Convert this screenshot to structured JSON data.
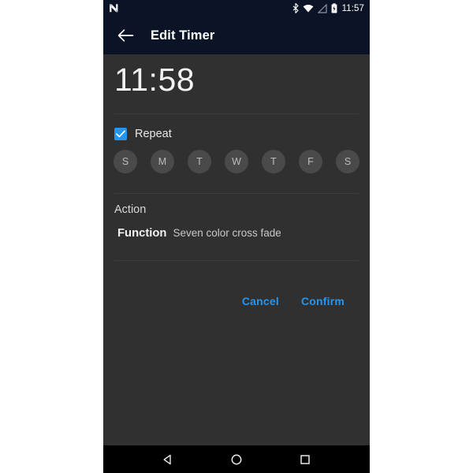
{
  "status_bar": {
    "logo_icon": "android-n-logo-icon",
    "icons": [
      {
        "name": "bluetooth-icon"
      },
      {
        "name": "wifi-off-icon"
      },
      {
        "name": "cellular-signal-off-icon"
      },
      {
        "name": "battery-icon"
      }
    ],
    "time": "11:57"
  },
  "toolbar": {
    "back_icon": "back-arrow-icon",
    "title": "Edit Timer"
  },
  "content": {
    "time_value": "11:58",
    "repeat": {
      "label": "Repeat",
      "checked": true,
      "check_icon": "checkmark-icon"
    },
    "days": [
      {
        "label": "S",
        "selected": false
      },
      {
        "label": "M",
        "selected": false
      },
      {
        "label": "T",
        "selected": false
      },
      {
        "label": "W",
        "selected": false
      },
      {
        "label": "T",
        "selected": false
      },
      {
        "label": "F",
        "selected": false
      },
      {
        "label": "S",
        "selected": false
      }
    ],
    "action": {
      "section_label": "Action",
      "function_key": "Function",
      "function_value": "Seven color cross fade"
    },
    "buttons": {
      "cancel": "Cancel",
      "confirm": "Confirm"
    }
  },
  "nav_bar": {
    "back_icon": "nav-back-triangle-icon",
    "home_icon": "nav-home-circle-icon",
    "recents_icon": "nav-recents-square-icon"
  },
  "colors": {
    "toolbar_bg": "#0b1426",
    "content_bg": "#303030",
    "accent": "#2196f3",
    "nav_bg": "#000000",
    "day_circle": "#4a4a4a"
  }
}
